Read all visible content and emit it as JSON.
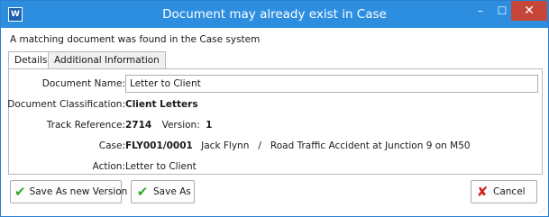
{
  "window": {
    "title": "Document may already exist in Case",
    "app_icon_text": "W",
    "minimize_glyph": "–",
    "maximize_glyph": "☐",
    "close_glyph": "✕"
  },
  "message": "A matching document was found in the Case system",
  "tabs": [
    {
      "label": "Details",
      "active": true
    },
    {
      "label": "Additional Information",
      "active": false
    }
  ],
  "details": {
    "document_name_label": "Document Name:",
    "document_name_value": "Letter to Client",
    "classification_label": "Document Classification:",
    "classification_value": "Client Letters",
    "track_label": "Track Reference:",
    "track_value": "2714",
    "version_label": "Version:",
    "version_value": "1",
    "case_label": "Case:",
    "case_id": "FLY001/0001",
    "case_description": "Jack Flynn   /   Road Traffic Accident at Junction 9 on M50",
    "action_label": "Action:",
    "action_value": "Letter to Client"
  },
  "buttons": {
    "save_new_version": "Save As new Version",
    "save_as": "Save As",
    "cancel": "Cancel"
  },
  "icons": {
    "check": "check-icon",
    "cross": "cross-icon",
    "app": "word-icon"
  },
  "colors": {
    "titlebar": "#2d8ee0",
    "close_button": "#c7463a",
    "check": "#2da82d",
    "cross": "#d32020"
  }
}
